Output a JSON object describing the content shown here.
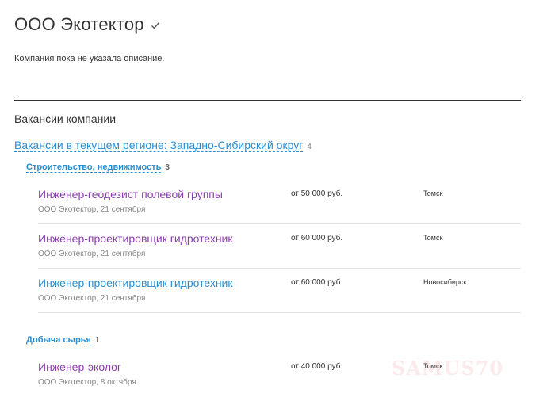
{
  "company": {
    "name": "ООО Экотектор",
    "verified_icon": "checkmark-icon",
    "description": "Компания пока не указала описание."
  },
  "vacancies_section": {
    "title": "Вакансии компании",
    "region": {
      "label": "Вакансии в текущем регионе: Западно-Сибирский округ",
      "count": "4"
    },
    "categories": [
      {
        "name": "Строительство, недвижимость",
        "count": "3",
        "items": [
          {
            "title": "Инженер-геодезист полевой группы",
            "meta": "ООО Экотектор, 21 сентября",
            "salary": "от 50 000 руб.",
            "city": "Томск"
          },
          {
            "title": "Инженер-проектировщик гидротехник",
            "meta": "ООО Экотектор, 21 сентября",
            "salary": "от 60 000 руб.",
            "city": "Томск"
          },
          {
            "title": "Инженер-проектировщик гидротехник",
            "meta": "ООО Экотектор, 21 сентября",
            "salary": "от 60 000 руб.",
            "city": "Новосибирск"
          }
        ]
      },
      {
        "name": "Добыча сырья",
        "count": "1",
        "items": [
          {
            "title": "Инженер-эколог",
            "meta": "ООО Экотектор, 8 октября",
            "salary": "от 40 000 руб.",
            "city": "Томск"
          }
        ]
      }
    ]
  },
  "colors": {
    "link_blue": "#2a8ed1",
    "visited_purple": "#8c3fb0",
    "text": "#333333",
    "muted": "#888888"
  },
  "watermark": "SAMUS70"
}
